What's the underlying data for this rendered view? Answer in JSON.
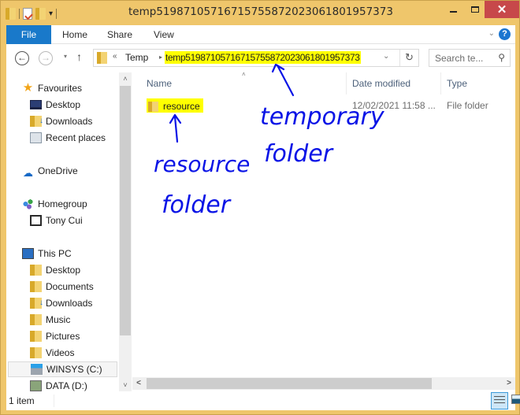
{
  "window": {
    "title": "temp51987105716715755872023061801957373",
    "controls": {
      "minimize": "minimize",
      "maximize": "maximize",
      "close": "✕"
    }
  },
  "quick_access": {
    "icons": [
      "folder-icon",
      "properties-icon",
      "new-folder-icon"
    ],
    "customize": "▾"
  },
  "ribbon": {
    "tabs": [
      "File",
      "Home",
      "Share",
      "View"
    ],
    "expand": "⌄",
    "help": "?"
  },
  "navigation": {
    "back": "←",
    "forward": "→",
    "recent": "▾",
    "up": "↑",
    "address": {
      "overflow": "«",
      "crumbs": [
        "Temp",
        "temp51987105716715755872023061801957373"
      ],
      "separator": "▸",
      "dropdown": "⌄",
      "refresh": "↻"
    },
    "search": {
      "placeholder": "Search te...",
      "icon": "⚲"
    }
  },
  "sidebar": {
    "groups": [
      {
        "label": "Favourites",
        "icon": "star-icon",
        "items": [
          {
            "label": "Desktop",
            "icon": "desktop-icon"
          },
          {
            "label": "Downloads",
            "icon": "downloads-icon"
          },
          {
            "label": "Recent places",
            "icon": "recent-places-icon"
          }
        ]
      },
      {
        "label": "OneDrive",
        "icon": "onedrive-icon",
        "items": []
      },
      {
        "label": "Homegroup",
        "icon": "homegroup-icon",
        "items": [
          {
            "label": "Tony Cui",
            "icon": "user-icon"
          }
        ]
      },
      {
        "label": "This PC",
        "icon": "this-pc-icon",
        "items": [
          {
            "label": "Desktop",
            "icon": "desktop-folder-icon"
          },
          {
            "label": "Documents",
            "icon": "documents-icon"
          },
          {
            "label": "Downloads",
            "icon": "downloads-icon"
          },
          {
            "label": "Music",
            "icon": "music-icon"
          },
          {
            "label": "Pictures",
            "icon": "pictures-icon"
          },
          {
            "label": "Videos",
            "icon": "videos-icon"
          },
          {
            "label": "WINSYS (C:)",
            "icon": "system-drive-icon",
            "selected": true
          },
          {
            "label": "DATA (D:)",
            "icon": "network-drive-icon"
          }
        ]
      }
    ]
  },
  "file_list": {
    "columns": [
      "Name",
      "Date modified",
      "Type"
    ],
    "sort_indicator": "˄",
    "rows": [
      {
        "name": "resource",
        "date_modified": "12/02/2021 11:58 ...",
        "type": "File folder",
        "highlighted": true
      }
    ]
  },
  "scrollbars": {
    "up": "˄",
    "down": "˅",
    "left": "<",
    "right": ">"
  },
  "status_bar": {
    "item_count": "1 item",
    "views": [
      "details-view",
      "large-icons-view"
    ]
  },
  "annotations": {
    "color": "#0a14e6",
    "highlight_color": "#ffff00",
    "texts": [
      "temporary",
      "folder",
      "resource",
      "folder"
    ]
  }
}
